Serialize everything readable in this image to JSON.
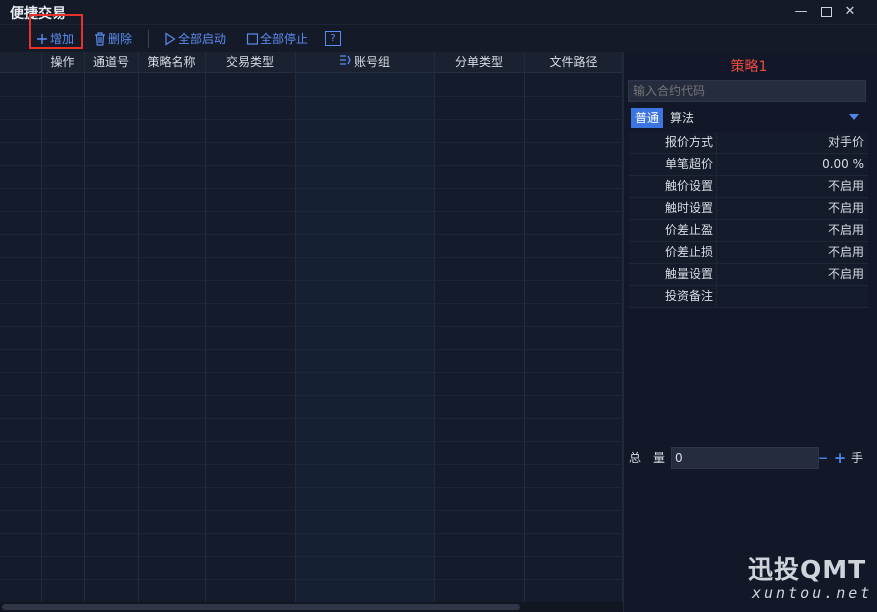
{
  "window": {
    "title": "便捷交易",
    "minimize": "—",
    "close": "✕"
  },
  "toolbar": {
    "add": "增加",
    "delete": "删除",
    "start_all": "全部启动",
    "stop_all": "全部停止",
    "help": "?"
  },
  "grid": {
    "columns": [
      "操作",
      "通道号",
      "策略名称",
      "交易类型",
      "账号组",
      "分单类型",
      "文件路径"
    ]
  },
  "panel": {
    "strategy_title": "策略1",
    "code_placeholder": "输入合约代码",
    "mode_active": "普通",
    "mode_other": "算法",
    "params": [
      {
        "name": "报价方式",
        "value": "对手价"
      },
      {
        "name": "单笔超价",
        "value": "0.00 %"
      },
      {
        "name": "触价设置",
        "value": "不启用"
      },
      {
        "name": "触时设置",
        "value": "不启用"
      },
      {
        "name": "价差止盈",
        "value": "不启用"
      },
      {
        "name": "价差止损",
        "value": "不启用"
      },
      {
        "name": "触量设置",
        "value": "不启用"
      },
      {
        "name": "投资备注",
        "value": ""
      }
    ],
    "total_label": "总量",
    "total_value": "0",
    "minus": "−",
    "plus": "+",
    "unit": "手"
  },
  "watermark": {
    "brand": "迅投QMT",
    "url": "xuntou.net"
  },
  "colors": {
    "accent": "#3d75e0",
    "strategy_title": "#ef4a40",
    "highlight": "#e8312a"
  }
}
